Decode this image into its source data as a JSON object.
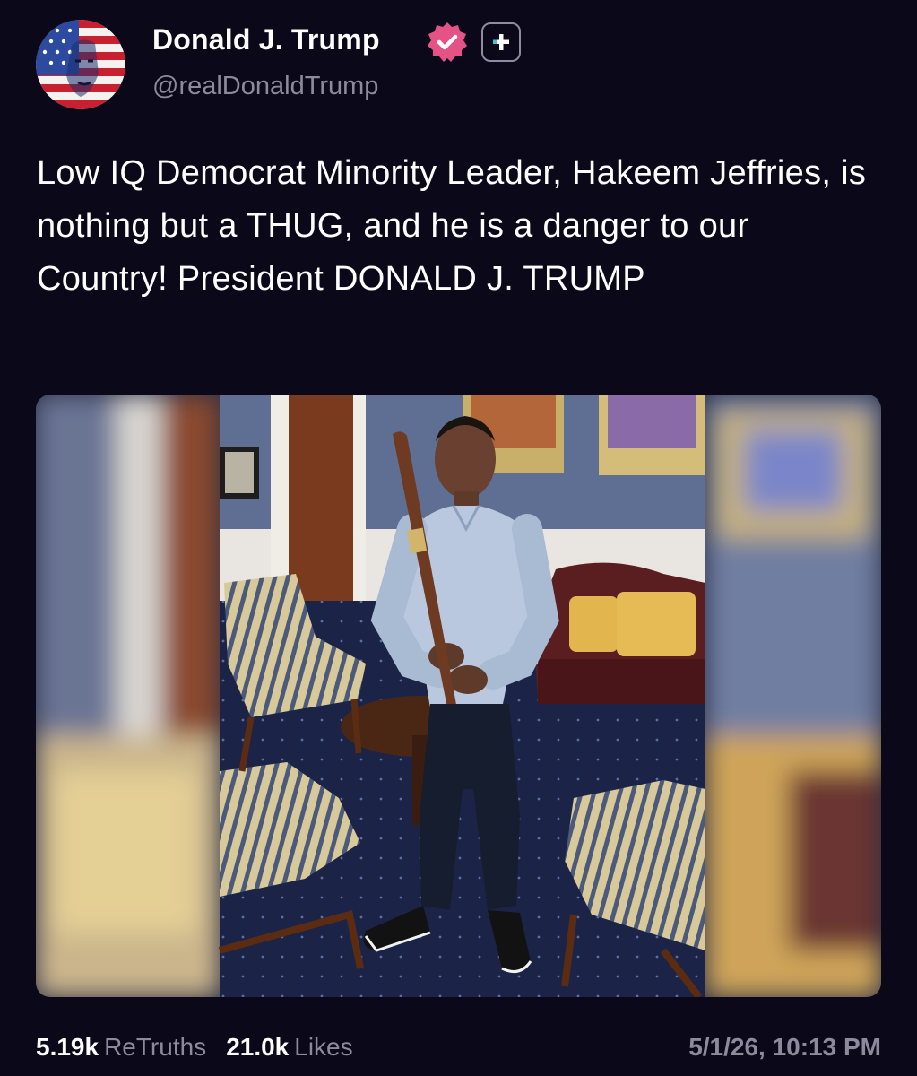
{
  "author": {
    "display_name": "Donald J. Trump",
    "handle": "@realDonaldTrump",
    "verified": true,
    "avatar_icon": "american-flag-portrait-avatar",
    "badge_color": "#e45383"
  },
  "post": {
    "text": "Low IQ Democrat Minority Leader, Hakeem Jeffries, is nothing but a THUG, and he is a danger to our Country! President DONALD J. TRUMP",
    "media": {
      "kind": "photo",
      "subject": "man in office holding baseball bat"
    }
  },
  "stats": {
    "retruths_count": "5.19k",
    "retruths_label": "ReTruths",
    "likes_count": "21.0k",
    "likes_label": "Likes",
    "timestamp": "5/1/26, 10:13 PM"
  },
  "colors": {
    "background": "#0b0819",
    "muted_text": "#8c8a9c",
    "primary_text": "#ffffff"
  }
}
